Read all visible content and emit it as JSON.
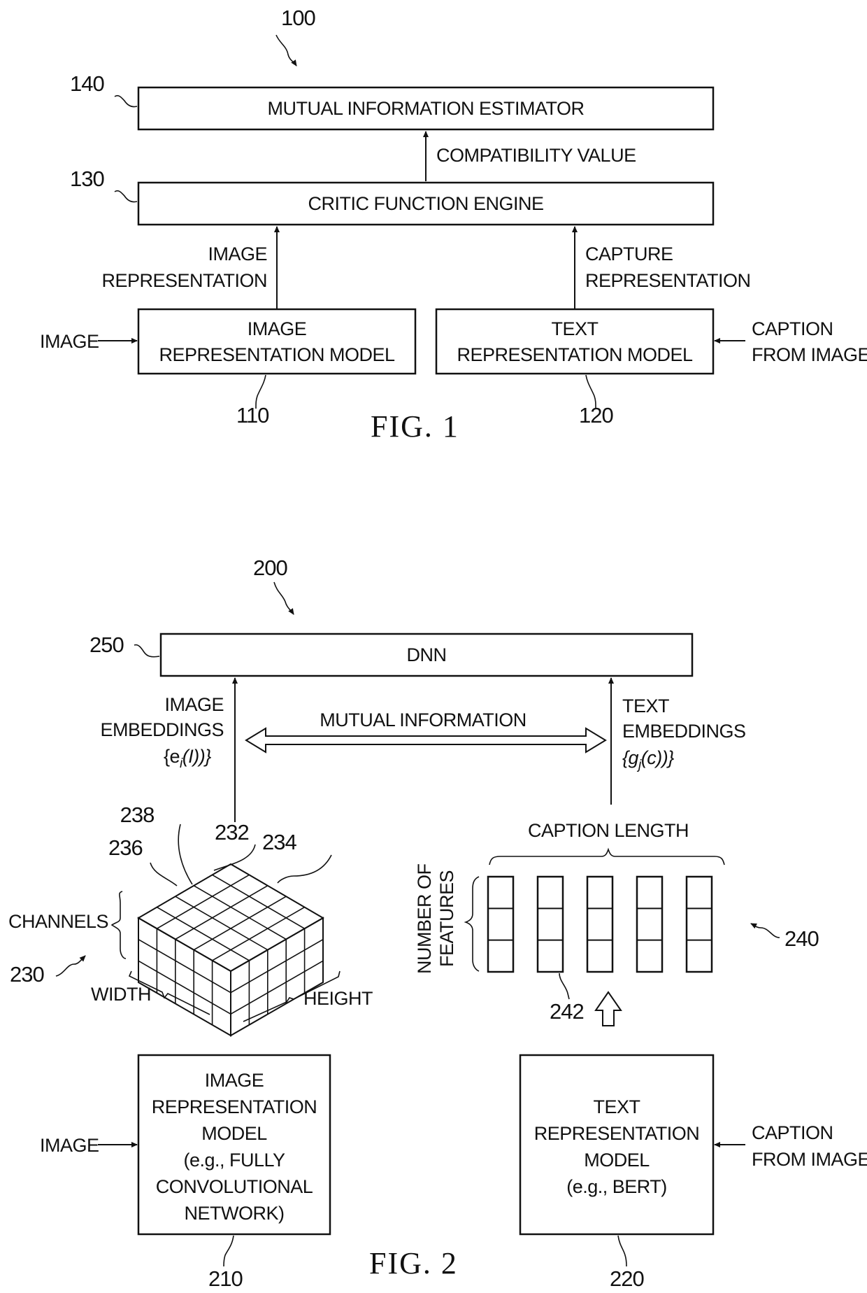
{
  "figure1": {
    "ref": "100",
    "caption": "FIG. 1",
    "blocks": {
      "mie": {
        "ref": "140",
        "label": "MUTUAL INFORMATION ESTIMATOR"
      },
      "cfe": {
        "ref": "130",
        "label": "CRITIC FUNCTION ENGINE"
      },
      "irm": {
        "ref": "110",
        "line1": "IMAGE",
        "line2": "REPRESENTATION MODEL"
      },
      "trm": {
        "ref": "120",
        "line1": "TEXT",
        "line2": "REPRESENTATION MODEL"
      }
    },
    "edges": {
      "compat": "COMPATIBILITY VALUE",
      "img_rep_1": "IMAGE",
      "img_rep_2": "REPRESENTATION",
      "cap_rep_1": "CAPTURE",
      "cap_rep_2": "REPRESENTATION",
      "image_in": "IMAGE",
      "caption_in_1": "CAPTION",
      "caption_in_2": "FROM IMAGE"
    }
  },
  "figure2": {
    "ref": "200",
    "caption": "FIG. 2",
    "blocks": {
      "dnn": {
        "ref": "250",
        "label": "DNN"
      },
      "irm": {
        "ref": "210",
        "lines": [
          "IMAGE",
          "REPRESENTATION",
          "MODEL",
          "(e.g., FULLY",
          "CONVOLUTIONAL",
          "NETWORK)"
        ]
      },
      "trm": {
        "ref": "220",
        "lines": [
          "TEXT",
          "REPRESENTATION",
          "MODEL",
          "(e.g., BERT)"
        ]
      }
    },
    "edges": {
      "img_emb_1": "IMAGE",
      "img_emb_2": "EMBEDDINGS",
      "img_emb_math": "{e",
      "img_emb_sub": "i",
      "img_emb_tail": "(I))}",
      "txt_emb_1": "TEXT",
      "txt_emb_2": "EMBEDDINGS",
      "txt_emb_math": "{g",
      "txt_emb_sub": "j",
      "txt_emb_tail": "(c))}",
      "mutual": "MUTUAL INFORMATION",
      "image_in": "IMAGE",
      "caption_in_1": "CAPTION",
      "caption_in_2": "FROM IMAGE"
    },
    "tensor": {
      "ref": "230",
      "cell_refs": [
        "238",
        "236",
        "232",
        "234"
      ],
      "channels": "CHANNELS",
      "width": "WIDTH",
      "height": "HEIGHT"
    },
    "sequence": {
      "ref": "240",
      "column_ref": "242",
      "caption_length": "CAPTION LENGTH",
      "features_1": "NUMBER OF",
      "features_2": "FEATURES",
      "columns": 5,
      "rows": 3
    }
  }
}
